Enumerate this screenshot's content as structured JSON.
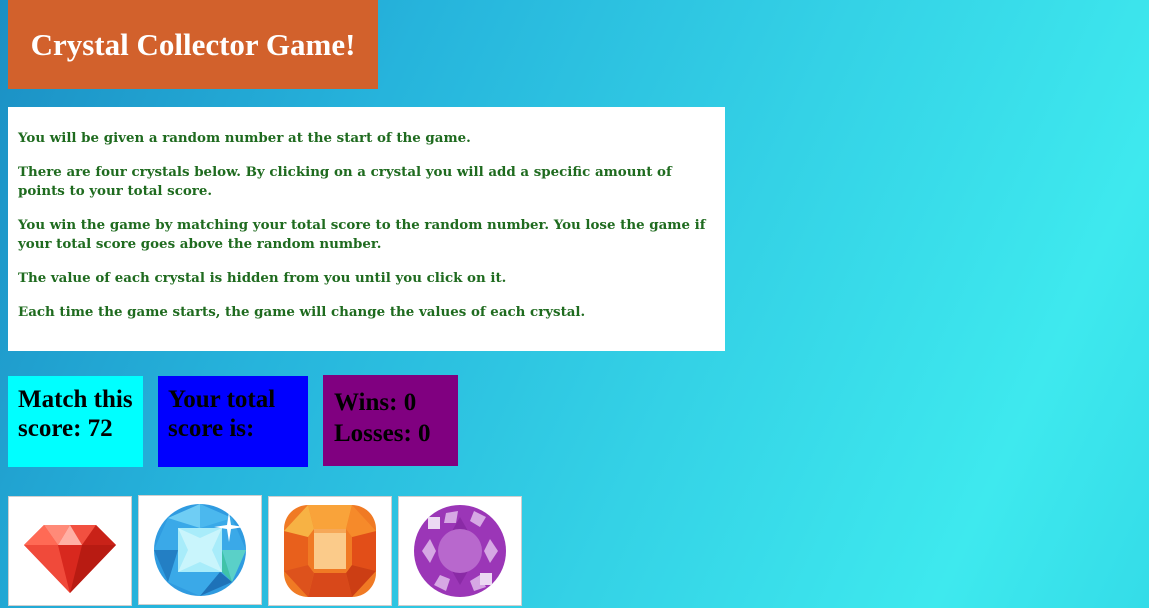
{
  "header": {
    "title": "Crystal Collector Game!"
  },
  "instructions": [
    "You will be given a random number at the start of the game.",
    "There are four crystals below. By clicking on a crystal you will add a specific amount of points to your total score.",
    "You win the game by matching your total score to the random number. You lose the game if your total score goes above the random number.",
    "The value of each crystal is hidden from you until you click on it.",
    "Each time the game starts, the game will change the values of each crystal."
  ],
  "scoreboard": {
    "target_label": "Match this score: 72",
    "total_label": "Your total score is:",
    "wins_label": "Wins: 0",
    "losses_label": "Losses: 0",
    "target_value": 72,
    "wins": 0,
    "losses": 0
  },
  "crystals": [
    {
      "icon": "red-gem-icon",
      "color": "#e8342a"
    },
    {
      "icon": "blue-diamond-icon",
      "color": "#2f9be0"
    },
    {
      "icon": "orange-gem-icon",
      "color": "#f07a24"
    },
    {
      "icon": "purple-gem-icon",
      "color": "#9b36b7"
    }
  ],
  "colors": {
    "title_bg": "#d2612c",
    "target_bg": "#00ffff",
    "total_bg": "#0000ff",
    "record_bg": "#800080",
    "instruction_text": "#1f6b1f"
  }
}
